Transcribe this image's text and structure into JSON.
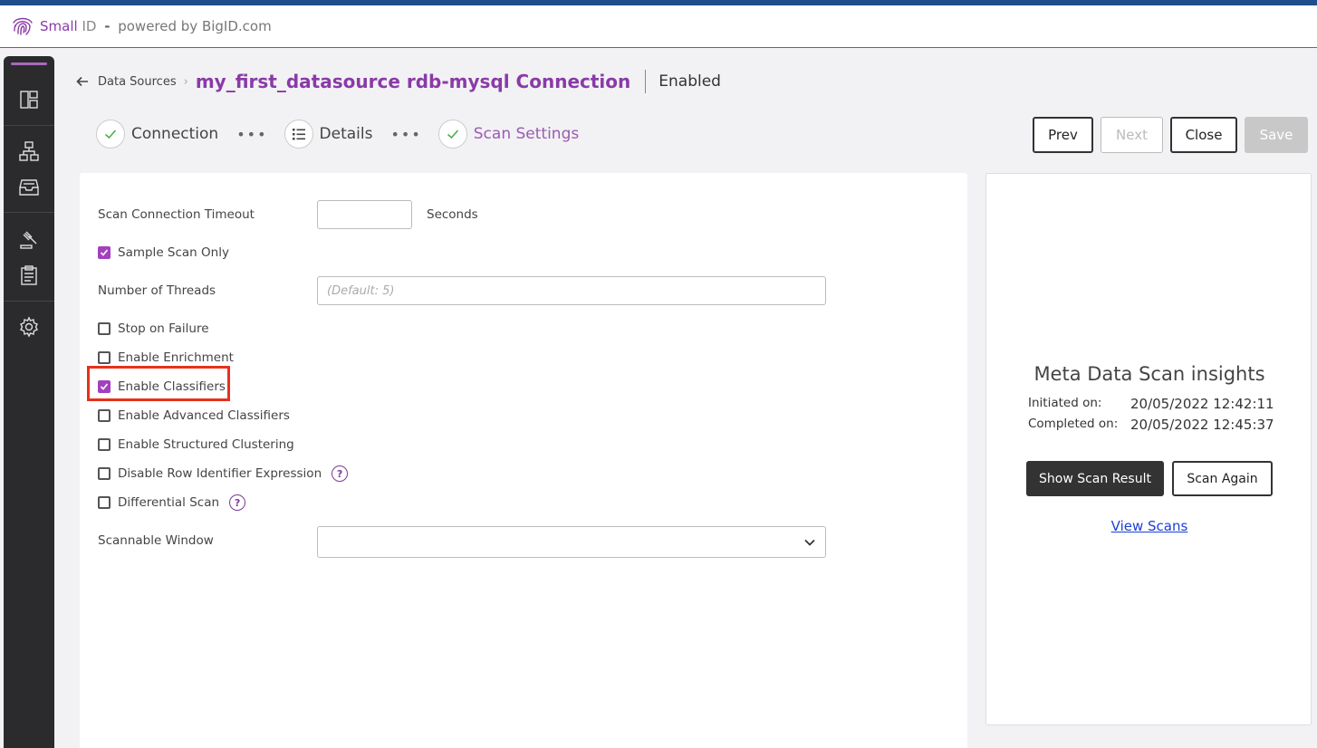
{
  "app": {
    "brand_name": "Small",
    "brand_id": "ID",
    "brand_sep": "-",
    "brand_powered": "powered by BigID.com"
  },
  "sidebar": {
    "items": [
      {
        "icon": "dashboard-icon"
      },
      {
        "icon": "sitemap-icon"
      },
      {
        "icon": "inbox-icon"
      },
      {
        "icon": "gavel-icon"
      },
      {
        "icon": "clipboard-icon"
      },
      {
        "icon": "gear-icon"
      }
    ]
  },
  "header": {
    "breadcrumb": "Data Sources",
    "title": "my_first_datasource rdb-mysql Connection",
    "status": "Enabled"
  },
  "stepper": {
    "steps": [
      {
        "label": "Connection",
        "icon": "check-icon"
      },
      {
        "label": "Details",
        "icon": "list-icon"
      },
      {
        "label": "Scan Settings",
        "icon": "check-icon"
      }
    ],
    "dots": "•••"
  },
  "actions": {
    "prev": "Prev",
    "next": "Next",
    "close": "Close",
    "save": "Save"
  },
  "form": {
    "timeout_label": "Scan Connection Timeout",
    "timeout_value": "",
    "timeout_unit": "Seconds",
    "threads_label": "Number of Threads",
    "threads_placeholder": "(Default: 5)",
    "window_label": "Scannable Window",
    "window_value": "",
    "checkboxes": [
      {
        "label": "Sample Scan Only",
        "checked": true
      },
      {
        "label": "Stop on Failure",
        "checked": false
      },
      {
        "label": "Enable Enrichment",
        "checked": false
      },
      {
        "label": "Enable Classifiers",
        "checked": true
      },
      {
        "label": "Enable Advanced Classifiers",
        "checked": false
      },
      {
        "label": "Enable Structured Clustering",
        "checked": false
      },
      {
        "label": "Disable Row Identifier Expression",
        "checked": false
      },
      {
        "label": "Differential Scan",
        "checked": false
      }
    ],
    "help_glyph": "?"
  },
  "insights": {
    "title": "Meta Data Scan insights",
    "initiated_label": "Initiated on:",
    "initiated_value": "20/05/2022 12:42:11",
    "completed_label": "Completed on:",
    "completed_value": "20/05/2022 12:45:37",
    "show_result": "Show Scan Result",
    "scan_again": "Scan Again",
    "view_scans": "View Scans"
  },
  "colors": {
    "brand": "#8a3aa8",
    "checkbox_on": "#a340bf",
    "highlight": "#e8311a",
    "link": "#1a3fd6"
  }
}
